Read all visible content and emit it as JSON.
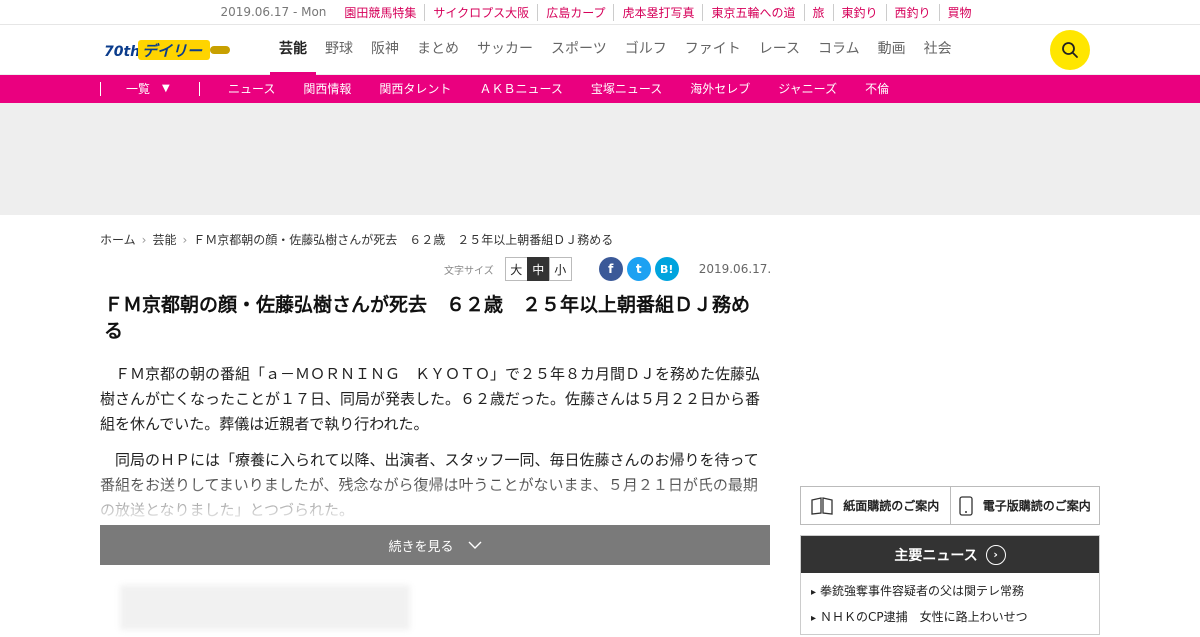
{
  "topbar": {
    "date": "2019.06.17 - Mon",
    "links": [
      "園田競馬特集",
      "サイクロプス大阪",
      "広島カープ",
      "虎本塁打写真",
      "東京五輪への道",
      "旅",
      "東釣り",
      "西釣り",
      "買物"
    ]
  },
  "header": {
    "logo_text": "デイリー",
    "logo_badge": "70th",
    "nav": [
      "芸能",
      "野球",
      "阪神",
      "まとめ",
      "サッカー",
      "スポーツ",
      "ゴルフ",
      "ファイト",
      "レース",
      "コラム",
      "動画",
      "社会"
    ],
    "active_nav": "芸能"
  },
  "subnav": {
    "all_label": "一覧",
    "items": [
      "ニュース",
      "関西情報",
      "関西タレント",
      "ＡＫＢニュース",
      "宝塚ニュース",
      "海外セレブ",
      "ジャニーズ",
      "不倫"
    ]
  },
  "breadcrumb": [
    "ホーム",
    "芸能",
    "ＦＭ京都朝の顔・佐藤弘樹さんが死去　６２歳　２５年以上朝番組ＤＪ務める"
  ],
  "tools": {
    "font_size_label": "文字サイズ",
    "sizes": [
      "大",
      "中",
      "小"
    ],
    "selected": "中",
    "share": [
      {
        "icon": "facebook-icon",
        "glyph": "f",
        "color": "#3b5998"
      },
      {
        "icon": "twitter-icon",
        "glyph": "t",
        "color": "#1da1f2"
      },
      {
        "icon": "hatena-icon",
        "glyph": "B!",
        "color": "#00a4de"
      }
    ],
    "date": "2019.06.17."
  },
  "article": {
    "title": "ＦＭ京都朝の顔・佐藤弘樹さんが死去　６２歳　２５年以上朝番組ＤＪ務める",
    "paragraphs": [
      "ＦＭ京都の朝の番組「ａ－ＭＯＲＮＩＮＧ　ＫＹＯＴＯ」で２５年８カ月間ＤＪを務めた佐藤弘樹さんが亡くなったことが１７日、同局が発表した。６２歳だった。佐藤さんは５月２２日から番組を休んでいた。葬儀は近親者で執り行われた。",
      "同局のＨＰには「療養に入られて以降、出演者、スタッフ一同、毎日佐藤さんのお帰りを待って番組をお送りしてまいりましたが、残念ながら復帰は叶うことがないまま、５月２１日が氏の最期の放送となりました」とつづられた。"
    ],
    "more_label": "続きを見る"
  },
  "sidebar": {
    "subscribe_print": "紙面購読のご案内",
    "subscribe_digital": "電子版購読のご案内",
    "news_title": "主要ニュース",
    "news_items": [
      "拳銃強奪事件容疑者の父は関テレ常務",
      "ＮＨＫのCP逮捕　女性に路上わいせつ"
    ]
  },
  "colors": {
    "accent": "#ea007f",
    "search": "#ffe600",
    "logo_yellow": "#ffd400",
    "logo_blue": "#0b3c8c"
  }
}
